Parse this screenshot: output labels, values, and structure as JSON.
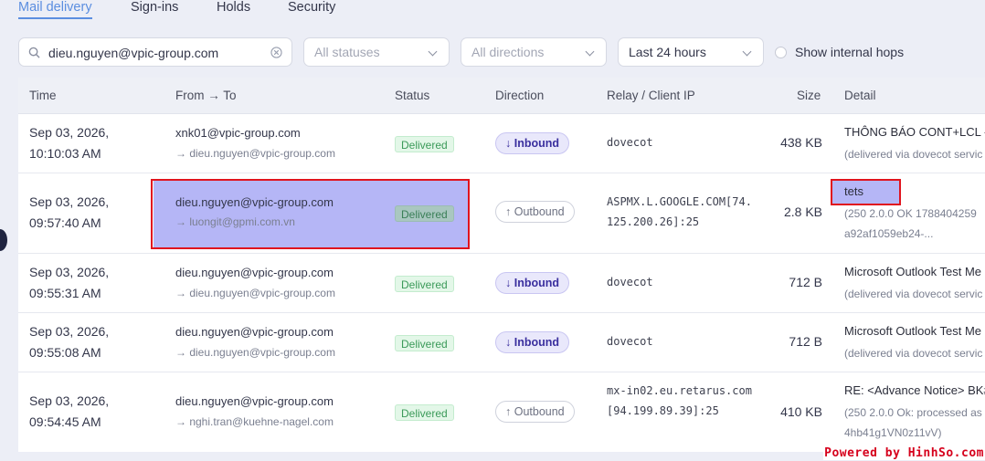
{
  "tabs": [
    {
      "label": "Mail delivery",
      "active": true
    },
    {
      "label": "Sign-ins",
      "active": false
    },
    {
      "label": "Holds",
      "active": false
    },
    {
      "label": "Security",
      "active": false
    }
  ],
  "filters": {
    "search_value": "dieu.nguyen@vpic-group.com",
    "status": "All statuses",
    "direction": "All directions",
    "range": "Last 24 hours",
    "internal_hops_label": "Show internal hops"
  },
  "columns": [
    "Time",
    "From → To",
    "Status",
    "Direction",
    "Relay / Client IP",
    "Size",
    "Detail"
  ],
  "rows": [
    {
      "time1": "Sep 03, 2026,",
      "time2": "10:10:03 AM",
      "from": "xnk01@vpic-group.com",
      "to": "→ dieu.nguyen@vpic-group.com",
      "status": "Delivered",
      "direction": "↓ Inbound",
      "relay": "dovecot",
      "size": "438 KB",
      "detail_title": "THÔNG BÁO CONT+LCL -",
      "detail_sub1": "(delivered via dovecot servic",
      "detail_sub2": ""
    },
    {
      "time1": "Sep 03, 2026,",
      "time2": "09:57:40 AM",
      "from": "dieu.nguyen@vpic-group.com",
      "to": "→ luongit@gpmi.com.vn",
      "status": "Delivered",
      "direction": "↑ Outbound",
      "relay": "ASPMX.L.GOOGLE.COM[74.125.200.26]:25",
      "size": "2.8 KB",
      "detail_title": "tets",
      "detail_sub1": "(250 2.0.0 OK 1788404259",
      "detail_sub2": "a92af1059eb24-..."
    },
    {
      "time1": "Sep 03, 2026,",
      "time2": "09:55:31 AM",
      "from": "dieu.nguyen@vpic-group.com",
      "to": "→ dieu.nguyen@vpic-group.com",
      "status": "Delivered",
      "direction": "↓ Inbound",
      "relay": "dovecot",
      "size": "712 B",
      "detail_title": "Microsoft Outlook Test Me",
      "detail_sub1": "(delivered via dovecot servic",
      "detail_sub2": ""
    },
    {
      "time1": "Sep 03, 2026,",
      "time2": "09:55:08 AM",
      "from": "dieu.nguyen@vpic-group.com",
      "to": "→ dieu.nguyen@vpic-group.com",
      "status": "Delivered",
      "direction": "↓ Inbound",
      "relay": "dovecot",
      "size": "712 B",
      "detail_title": "Microsoft Outlook Test Me",
      "detail_sub1": "(delivered via dovecot servic",
      "detail_sub2": ""
    },
    {
      "time1": "Sep 03, 2026,",
      "time2": "09:54:45 AM",
      "from": "dieu.nguyen@vpic-group.com",
      "to": "→ nghi.tran@kuehne-nagel.com",
      "status": "Delivered",
      "direction": "↑ Outbound",
      "relay": "mx-in02.eu.retarus.com[94.199.89.39]:25",
      "size": "410 KB",
      "detail_title": "RE: <Advance Notice> BK#",
      "detail_sub1": "(250 2.0.0 Ok: processed as",
      "detail_sub2": "4hb41g1VN0z11vV)"
    }
  ],
  "watermark": "Powered by HinhSo.com",
  "colors": {
    "accent": "#5b8ee0",
    "highlight": "#b5b6f6",
    "annotation": "#e0141e",
    "delivered": "#3b9a59"
  }
}
